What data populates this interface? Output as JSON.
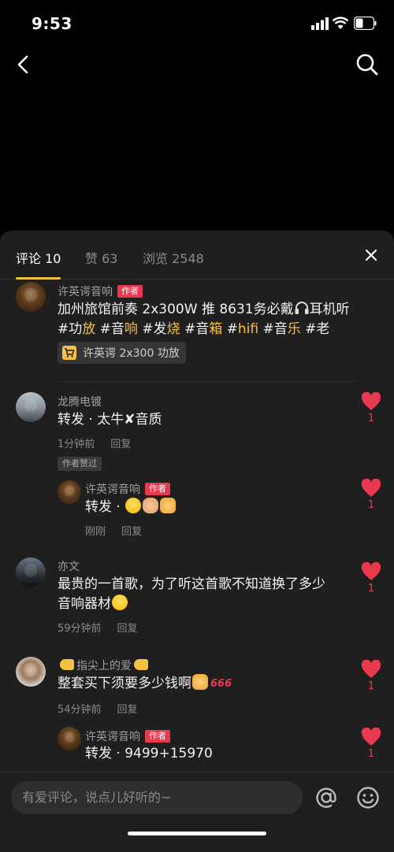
{
  "status_bar": {
    "time": "9:53"
  },
  "tabs": {
    "comments": "评论 10",
    "likes": "赞 63",
    "views": "浏览 2548"
  },
  "author_tag": "作者",
  "post": {
    "author": "许英谔音响",
    "text_plain": "加州旅馆前奏 2x300W 推 8631务必戴",
    "text_after_icon": "耳机听#功",
    "hashtags": [
      "放",
      "#音",
      "响",
      " #发",
      "烧",
      " #音",
      "箱",
      " #",
      "hifi",
      " #音",
      "乐",
      " #老"
    ],
    "product": "许英谔 2x300 功放"
  },
  "comments": [
    {
      "author": "龙腾电镀",
      "text": "转发 · 太牛✘音质",
      "time": "1分钟前",
      "reply": "回复",
      "liked_by_author": "作者赞过",
      "likes": "1",
      "reply_item": {
        "author": "许英谔音响",
        "text": "转发 · ",
        "time": "刚刚",
        "reply": "回复",
        "likes": "1"
      }
    },
    {
      "author": "亦文",
      "text_line1": "最贵的一首歌，为了听这首歌不知道换了多少",
      "text_line2": "音响器材",
      "time": "59分钟前",
      "reply": "回复",
      "likes": "1"
    },
    {
      "author": "指尖上的爱",
      "text": "整套买下须要多少钱啊",
      "emoji_666": "666",
      "time": "54分钟前",
      "reply": "回复",
      "likes": "1",
      "reply_item": {
        "author": "许英谔音响",
        "text": "转发 · 9499+15970",
        "likes": "1"
      }
    }
  ],
  "input": {
    "placeholder": "有爱评论，说点儿好听的~"
  },
  "colors": {
    "accent": "#f4c140",
    "like": "#e9394f",
    "sheet": "#1f1f1f"
  }
}
